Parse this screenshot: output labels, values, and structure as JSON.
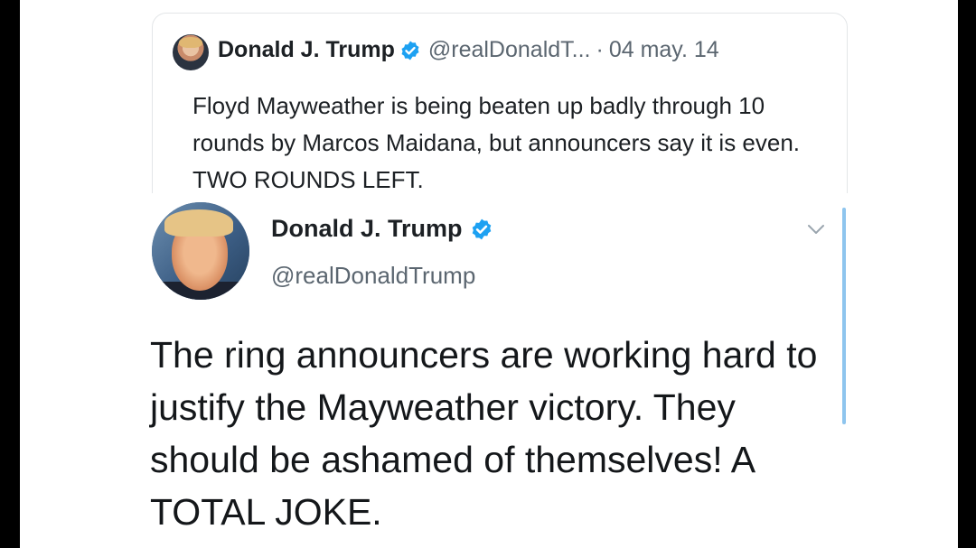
{
  "quoted_tweet": {
    "display_name": "Donald J. Trump",
    "handle": "@realDonaldT...",
    "separator": "·",
    "date": "04 may. 14",
    "text": "Floyd Mayweather is being beaten up badly through 10 rounds by Marcos Maidana, but announcers say it is even. TWO ROUNDS LEFT."
  },
  "tweet": {
    "display_name": "Donald J. Trump",
    "handle": "@realDonaldTrump",
    "text": "The ring announcers are working hard to justify the Mayweather victory. They should be ashamed of themselves! A TOTAL JOKE."
  },
  "icons": {
    "verified": "verified-badge-icon",
    "menu": "chevron-down-icon"
  },
  "colors": {
    "verified_blue": "#1da1f2",
    "text_primary": "#14171a",
    "text_secondary": "#5b6670",
    "accent_bar": "#8ec5ee"
  }
}
